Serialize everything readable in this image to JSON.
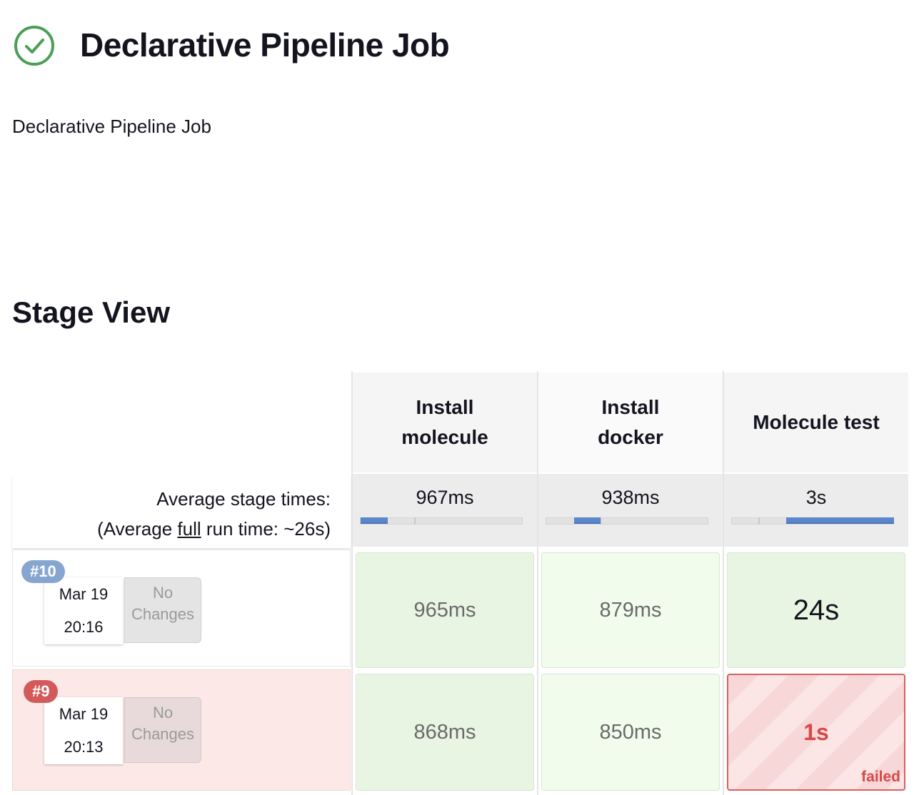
{
  "job": {
    "title": "Declarative Pipeline Job",
    "description": "Declarative Pipeline Job",
    "status_icon": "check-circle-icon",
    "status_color": "#4a9f55"
  },
  "stage_view": {
    "title": "Stage View",
    "avg_label": "Average stage times:",
    "avg_full_prefix": "(Average ",
    "avg_full_link": "full",
    "avg_full_suffix": " run time: ~26s)"
  },
  "stages": [
    {
      "name": "Install molecule",
      "avg": "967ms"
    },
    {
      "name": "Install docker",
      "avg": "938ms"
    },
    {
      "name": "Molecule test",
      "avg": "3s"
    }
  ],
  "runs": [
    {
      "number": "#10",
      "date": "Mar 19",
      "time": "20:16",
      "changes": "No Changes",
      "status": "success",
      "cells": [
        "965ms",
        "879ms",
        "24s"
      ]
    },
    {
      "number": "#9",
      "date": "Mar 19",
      "time": "20:13",
      "changes": "No Changes",
      "status": "failed",
      "cells": [
        "868ms",
        "850ms",
        "1s"
      ],
      "failed_label": "failed"
    }
  ],
  "colors": {
    "success_badge": "#86a6d0",
    "failed_badge": "#d25a5a",
    "bar_fill": "#5b86cc"
  }
}
